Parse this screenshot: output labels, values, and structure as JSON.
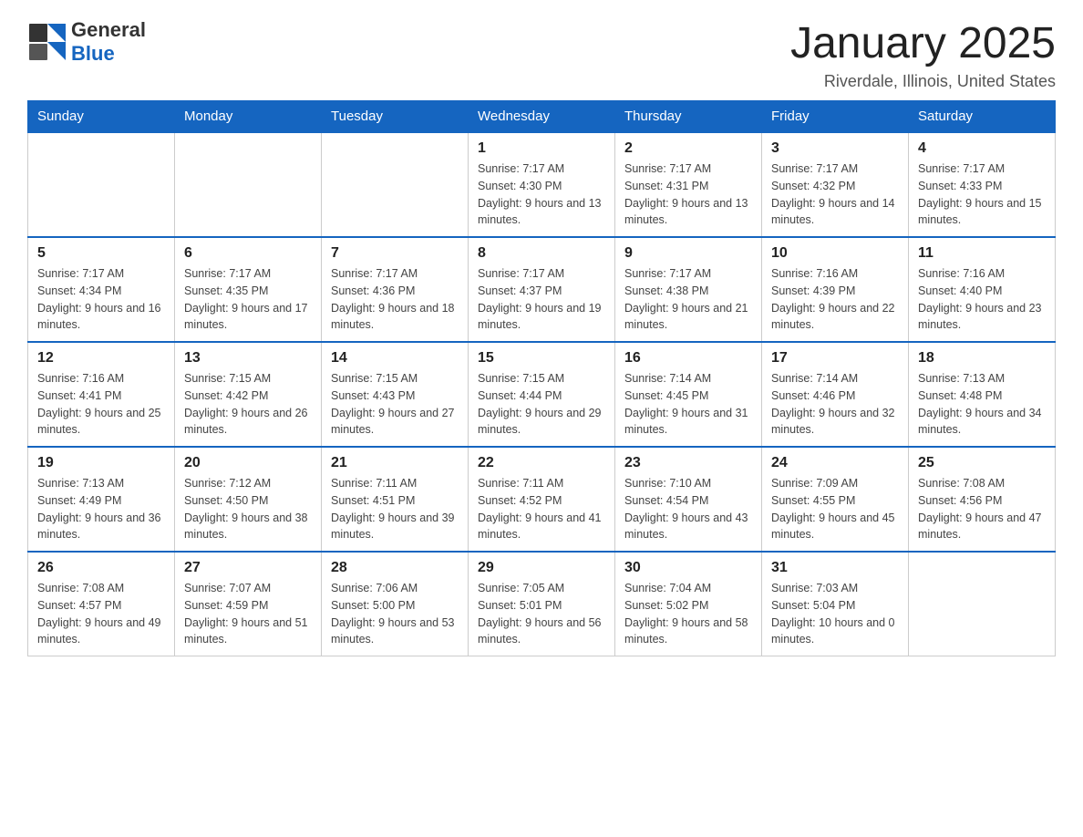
{
  "header": {
    "logo_line1": "General",
    "logo_line2": "Blue",
    "main_title": "January 2025",
    "subtitle": "Riverdale, Illinois, United States"
  },
  "days_of_week": [
    "Sunday",
    "Monday",
    "Tuesday",
    "Wednesday",
    "Thursday",
    "Friday",
    "Saturday"
  ],
  "weeks": [
    [
      {
        "day": "",
        "sunrise": "",
        "sunset": "",
        "daylight": ""
      },
      {
        "day": "",
        "sunrise": "",
        "sunset": "",
        "daylight": ""
      },
      {
        "day": "",
        "sunrise": "",
        "sunset": "",
        "daylight": ""
      },
      {
        "day": "1",
        "sunrise": "Sunrise: 7:17 AM",
        "sunset": "Sunset: 4:30 PM",
        "daylight": "Daylight: 9 hours and 13 minutes."
      },
      {
        "day": "2",
        "sunrise": "Sunrise: 7:17 AM",
        "sunset": "Sunset: 4:31 PM",
        "daylight": "Daylight: 9 hours and 13 minutes."
      },
      {
        "day": "3",
        "sunrise": "Sunrise: 7:17 AM",
        "sunset": "Sunset: 4:32 PM",
        "daylight": "Daylight: 9 hours and 14 minutes."
      },
      {
        "day": "4",
        "sunrise": "Sunrise: 7:17 AM",
        "sunset": "Sunset: 4:33 PM",
        "daylight": "Daylight: 9 hours and 15 minutes."
      }
    ],
    [
      {
        "day": "5",
        "sunrise": "Sunrise: 7:17 AM",
        "sunset": "Sunset: 4:34 PM",
        "daylight": "Daylight: 9 hours and 16 minutes."
      },
      {
        "day": "6",
        "sunrise": "Sunrise: 7:17 AM",
        "sunset": "Sunset: 4:35 PM",
        "daylight": "Daylight: 9 hours and 17 minutes."
      },
      {
        "day": "7",
        "sunrise": "Sunrise: 7:17 AM",
        "sunset": "Sunset: 4:36 PM",
        "daylight": "Daylight: 9 hours and 18 minutes."
      },
      {
        "day": "8",
        "sunrise": "Sunrise: 7:17 AM",
        "sunset": "Sunset: 4:37 PM",
        "daylight": "Daylight: 9 hours and 19 minutes."
      },
      {
        "day": "9",
        "sunrise": "Sunrise: 7:17 AM",
        "sunset": "Sunset: 4:38 PM",
        "daylight": "Daylight: 9 hours and 21 minutes."
      },
      {
        "day": "10",
        "sunrise": "Sunrise: 7:16 AM",
        "sunset": "Sunset: 4:39 PM",
        "daylight": "Daylight: 9 hours and 22 minutes."
      },
      {
        "day": "11",
        "sunrise": "Sunrise: 7:16 AM",
        "sunset": "Sunset: 4:40 PM",
        "daylight": "Daylight: 9 hours and 23 minutes."
      }
    ],
    [
      {
        "day": "12",
        "sunrise": "Sunrise: 7:16 AM",
        "sunset": "Sunset: 4:41 PM",
        "daylight": "Daylight: 9 hours and 25 minutes."
      },
      {
        "day": "13",
        "sunrise": "Sunrise: 7:15 AM",
        "sunset": "Sunset: 4:42 PM",
        "daylight": "Daylight: 9 hours and 26 minutes."
      },
      {
        "day": "14",
        "sunrise": "Sunrise: 7:15 AM",
        "sunset": "Sunset: 4:43 PM",
        "daylight": "Daylight: 9 hours and 27 minutes."
      },
      {
        "day": "15",
        "sunrise": "Sunrise: 7:15 AM",
        "sunset": "Sunset: 4:44 PM",
        "daylight": "Daylight: 9 hours and 29 minutes."
      },
      {
        "day": "16",
        "sunrise": "Sunrise: 7:14 AM",
        "sunset": "Sunset: 4:45 PM",
        "daylight": "Daylight: 9 hours and 31 minutes."
      },
      {
        "day": "17",
        "sunrise": "Sunrise: 7:14 AM",
        "sunset": "Sunset: 4:46 PM",
        "daylight": "Daylight: 9 hours and 32 minutes."
      },
      {
        "day": "18",
        "sunrise": "Sunrise: 7:13 AM",
        "sunset": "Sunset: 4:48 PM",
        "daylight": "Daylight: 9 hours and 34 minutes."
      }
    ],
    [
      {
        "day": "19",
        "sunrise": "Sunrise: 7:13 AM",
        "sunset": "Sunset: 4:49 PM",
        "daylight": "Daylight: 9 hours and 36 minutes."
      },
      {
        "day": "20",
        "sunrise": "Sunrise: 7:12 AM",
        "sunset": "Sunset: 4:50 PM",
        "daylight": "Daylight: 9 hours and 38 minutes."
      },
      {
        "day": "21",
        "sunrise": "Sunrise: 7:11 AM",
        "sunset": "Sunset: 4:51 PM",
        "daylight": "Daylight: 9 hours and 39 minutes."
      },
      {
        "day": "22",
        "sunrise": "Sunrise: 7:11 AM",
        "sunset": "Sunset: 4:52 PM",
        "daylight": "Daylight: 9 hours and 41 minutes."
      },
      {
        "day": "23",
        "sunrise": "Sunrise: 7:10 AM",
        "sunset": "Sunset: 4:54 PM",
        "daylight": "Daylight: 9 hours and 43 minutes."
      },
      {
        "day": "24",
        "sunrise": "Sunrise: 7:09 AM",
        "sunset": "Sunset: 4:55 PM",
        "daylight": "Daylight: 9 hours and 45 minutes."
      },
      {
        "day": "25",
        "sunrise": "Sunrise: 7:08 AM",
        "sunset": "Sunset: 4:56 PM",
        "daylight": "Daylight: 9 hours and 47 minutes."
      }
    ],
    [
      {
        "day": "26",
        "sunrise": "Sunrise: 7:08 AM",
        "sunset": "Sunset: 4:57 PM",
        "daylight": "Daylight: 9 hours and 49 minutes."
      },
      {
        "day": "27",
        "sunrise": "Sunrise: 7:07 AM",
        "sunset": "Sunset: 4:59 PM",
        "daylight": "Daylight: 9 hours and 51 minutes."
      },
      {
        "day": "28",
        "sunrise": "Sunrise: 7:06 AM",
        "sunset": "Sunset: 5:00 PM",
        "daylight": "Daylight: 9 hours and 53 minutes."
      },
      {
        "day": "29",
        "sunrise": "Sunrise: 7:05 AM",
        "sunset": "Sunset: 5:01 PM",
        "daylight": "Daylight: 9 hours and 56 minutes."
      },
      {
        "day": "30",
        "sunrise": "Sunrise: 7:04 AM",
        "sunset": "Sunset: 5:02 PM",
        "daylight": "Daylight: 9 hours and 58 minutes."
      },
      {
        "day": "31",
        "sunrise": "Sunrise: 7:03 AM",
        "sunset": "Sunset: 5:04 PM",
        "daylight": "Daylight: 10 hours and 0 minutes."
      },
      {
        "day": "",
        "sunrise": "",
        "sunset": "",
        "daylight": ""
      }
    ]
  ]
}
